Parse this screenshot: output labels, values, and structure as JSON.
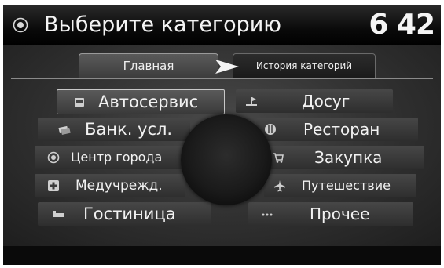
{
  "header": {
    "title": "Выберите категорию",
    "clock": "6 42",
    "icon": "nav-disc-icon"
  },
  "tabs": {
    "main": "Главная",
    "history": "История категорий"
  },
  "categories": {
    "left": [
      {
        "label": "Автосервис",
        "icon": "car-service-icon",
        "selected": true
      },
      {
        "label": "Банк. усл.",
        "icon": "bank-icon"
      },
      {
        "label": "Центр города",
        "icon": "city-center-icon"
      },
      {
        "label": "Медучрежд.",
        "icon": "medical-cross-icon"
      },
      {
        "label": "Гостиница",
        "icon": "hotel-bed-icon"
      }
    ],
    "right": [
      {
        "label": "Досуг",
        "icon": "leisure-icon"
      },
      {
        "label": "Ресторан",
        "icon": "restaurant-icon"
      },
      {
        "label": "Закупка",
        "icon": "shopping-cart-icon"
      },
      {
        "label": "Путешествие",
        "icon": "airplane-icon"
      },
      {
        "label": "Прочее",
        "icon": "more-dots-icon"
      }
    ]
  },
  "colors": {
    "screen_background": "#0c0c0c",
    "text": "#f2f2f2",
    "icon": "#d0d0d0"
  }
}
